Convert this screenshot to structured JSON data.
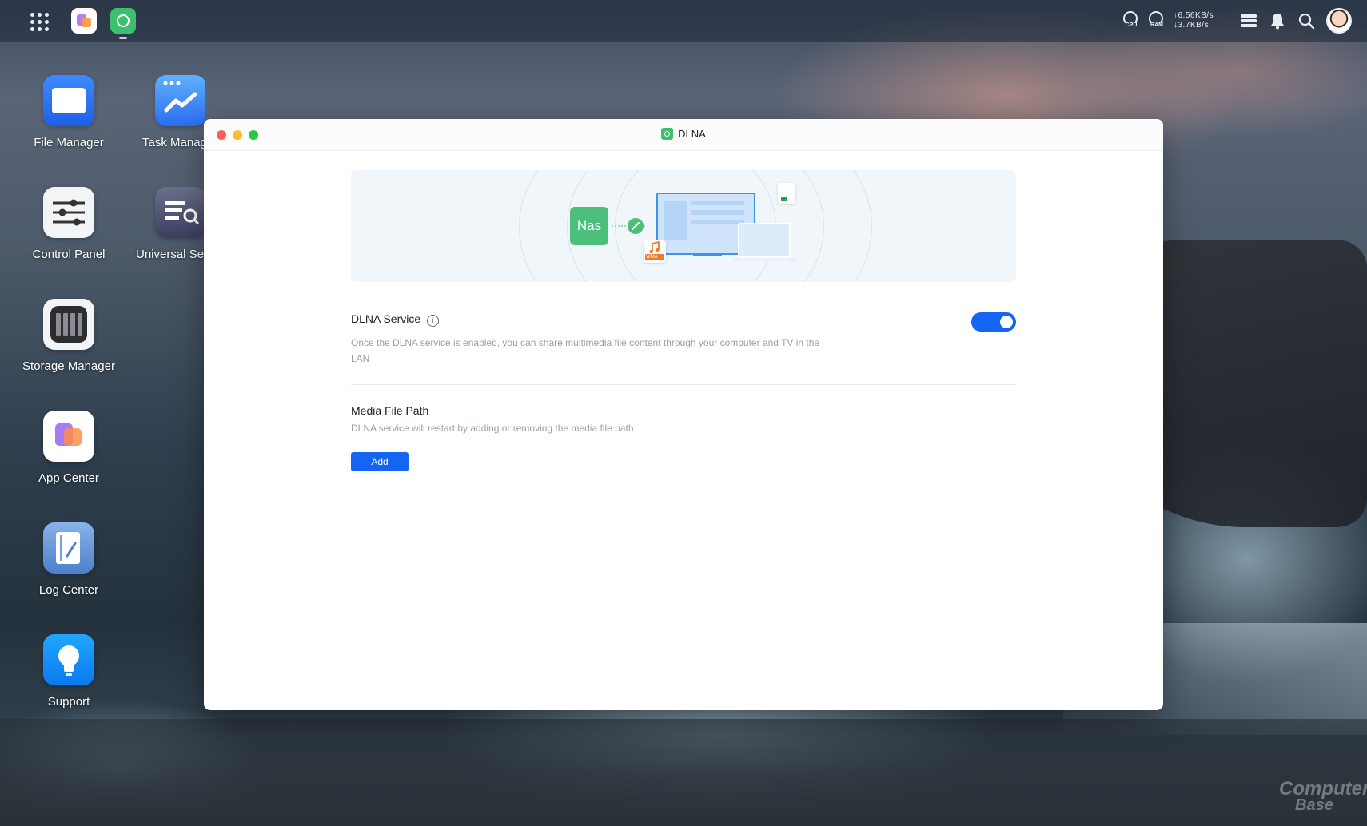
{
  "desktop": {
    "icons": [
      {
        "label": "File Manager",
        "icon": "folder-icon"
      },
      {
        "label": "Task Manag",
        "icon": "trend-chart-icon"
      },
      {
        "label": "Control Panel",
        "icon": "sliders-icon"
      },
      {
        "label": "Universal Sea",
        "icon": "search-doc-icon"
      },
      {
        "label": "Storage Manager",
        "icon": "drive-bays-icon"
      },
      {
        "label": "App Center",
        "icon": "app-center-icon"
      },
      {
        "label": "Log Center",
        "icon": "log-icon"
      },
      {
        "label": "Support",
        "icon": "lightbulb-icon"
      }
    ],
    "watermark": {
      "line1": "Computer",
      "line2": "Base"
    }
  },
  "topbar": {
    "cpu_label": "CPU",
    "ram_label": "RAM",
    "upload": "↑6.56KB/s",
    "download": "↓3.7KB/s"
  },
  "window": {
    "title": "DLNA",
    "banner": {
      "nas_label": "Nas",
      "music_badge": "WMA"
    },
    "dlna_service": {
      "title": "DLNA Service",
      "enabled": true,
      "description": "Once the DLNA service is enabled, you can share multimedia file content through your computer and TV in the LAN"
    },
    "media_file_path": {
      "title": "Media File Path",
      "description": "DLNA service will restart by adding or removing the media file path",
      "add_label": "Add"
    }
  },
  "colors": {
    "accent": "#1565f5",
    "dlna_green": "#3cbf6f"
  }
}
